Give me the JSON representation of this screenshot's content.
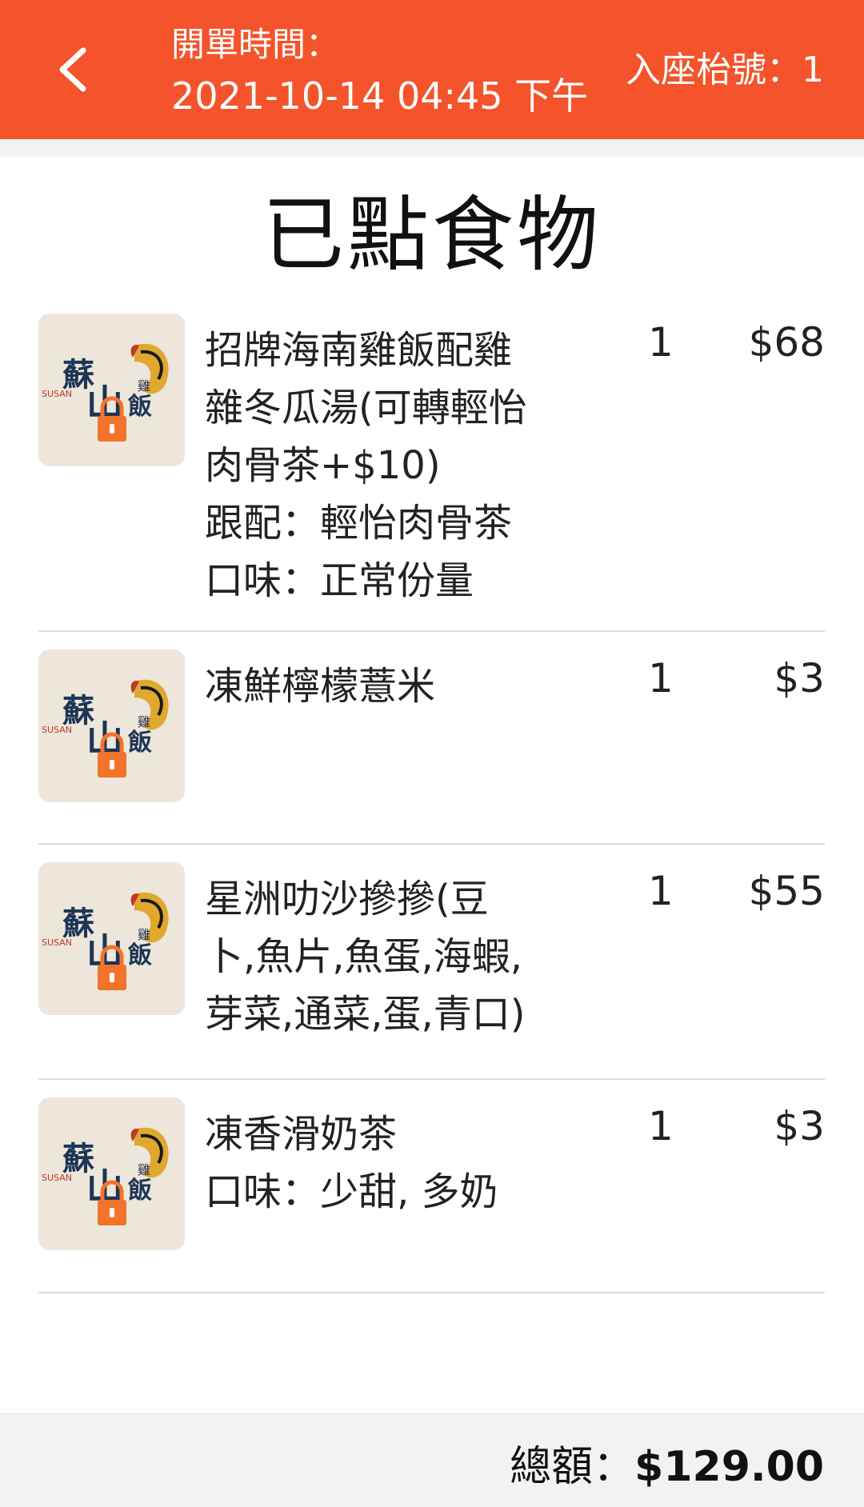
{
  "header": {
    "back_icon": "chevron-left-icon",
    "open_time_label": "開單時間：",
    "open_time_value": "2021-10-14 04:45 下午",
    "table_label": "入座枱號：1"
  },
  "page_title": "已點食物",
  "items": [
    {
      "image": "restaurant-logo-locked",
      "name_lines": [
        "招牌海南雞飯配雞",
        "雜冬瓜湯(可轉輕怡",
        "肉骨茶+$10)"
      ],
      "options": [
        "跟配：輕怡肉骨茶",
        "口味：正常份量"
      ],
      "qty": "1",
      "price": "$68"
    },
    {
      "image": "restaurant-logo-locked",
      "name_lines": [
        "凍鮮檸檬薏米"
      ],
      "options": [],
      "qty": "1",
      "price": "$3"
    },
    {
      "image": "restaurant-logo-locked",
      "name_lines": [
        "星洲叻沙摻摻(豆",
        "卜,魚片,魚蛋,海蝦,",
        "芽菜,通菜,蛋,青口)"
      ],
      "options": [],
      "qty": "1",
      "price": "$55"
    },
    {
      "image": "restaurant-logo-locked",
      "name_lines": [
        "凍香滑奶茶"
      ],
      "options": [
        "口味：少甜, 多奶"
      ],
      "qty": "1",
      "price": "$3"
    }
  ],
  "footer": {
    "total_label": "總額：",
    "total_value": "$129.00"
  },
  "colors": {
    "header_bg": "#f4532b",
    "lock": "#f4732b",
    "logo_text": "#1d3557"
  }
}
